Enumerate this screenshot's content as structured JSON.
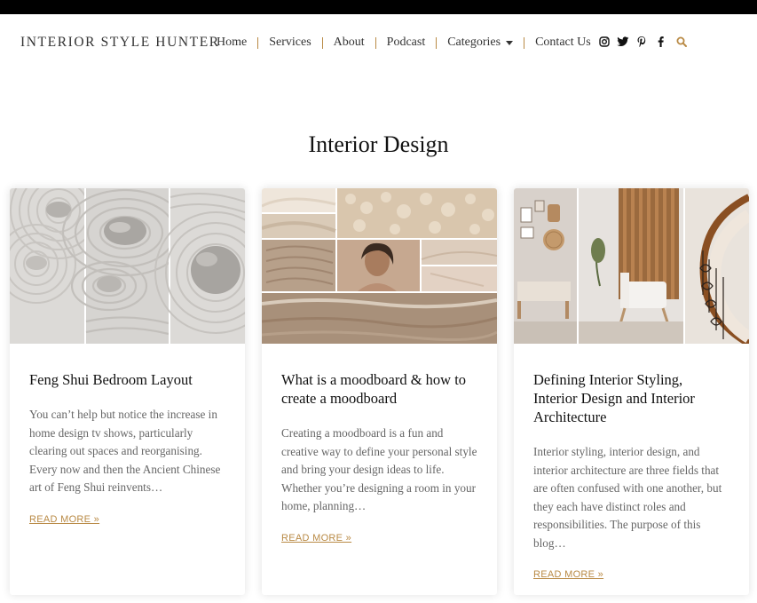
{
  "header": {
    "logo": "INTERIOR STYLE HUNTER",
    "nav": [
      {
        "label": "Home"
      },
      {
        "label": "Services"
      },
      {
        "label": "About"
      },
      {
        "label": "Podcast"
      },
      {
        "label": "Categories",
        "has_dropdown": true
      },
      {
        "label": "Contact Us"
      }
    ],
    "social_icons": [
      "instagram-icon",
      "twitter-icon",
      "pinterest-icon",
      "facebook-icon"
    ],
    "search_icon": "search-icon",
    "accent_color": "#b98a45"
  },
  "page": {
    "title": "Interior Design"
  },
  "posts": [
    {
      "title": "Feng Shui Bedroom Layout",
      "excerpt": "You can’t help but notice the increase in home design tv shows, particularly clearing out spaces and reorganising. Every now and then the Ancient Chinese art of Feng Shui reinvents…",
      "read_more": "READ MORE »"
    },
    {
      "title": "What is a moodboard & how to create a moodboard",
      "excerpt": "Creating a moodboard is a fun and creative way to define your personal style and bring your design ideas to life. Whether you’re designing a room in your home, planning…",
      "read_more": "READ MORE »"
    },
    {
      "title": "Defining Interior Styling, Interior Design and Interior Architecture",
      "excerpt": "Interior styling, interior design, and interior architecture are three fields that are often confused with one another, but they each have distinct roles and responsibilities. The purpose of this blog…",
      "read_more": "READ MORE »"
    }
  ]
}
